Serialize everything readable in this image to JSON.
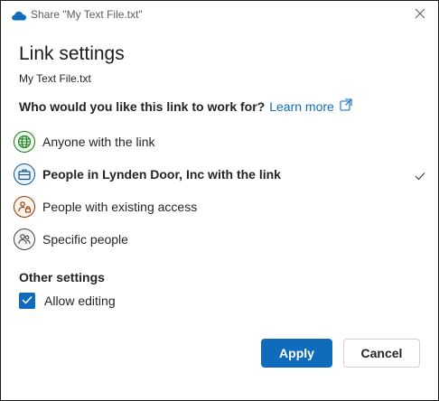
{
  "titlebar": {
    "title": "Share \"My Text File.txt\"",
    "app_icon": "onedrive-cloud-icon",
    "close_icon": "close-icon"
  },
  "dialog": {
    "heading": "Link settings",
    "filename": "My Text File.txt",
    "question": "Who would you like this link to work for?",
    "learn_more": "Learn more",
    "learn_more_icon": "open-in-new-window-icon"
  },
  "options": [
    {
      "label": "Anyone with the link",
      "icon": "globe-icon",
      "selected": false
    },
    {
      "label": "People in Lynden Door, Inc with the link",
      "icon": "organization-briefcase-icon",
      "selected": true
    },
    {
      "label": "People with existing access",
      "icon": "people-lock-icon",
      "selected": false
    },
    {
      "label": "Specific people",
      "icon": "people-icon",
      "selected": false
    }
  ],
  "other_settings": {
    "heading": "Other settings",
    "allow_editing": {
      "label": "Allow editing",
      "checked": true
    }
  },
  "buttons": {
    "apply": "Apply",
    "cancel": "Cancel"
  },
  "colors": {
    "accent": "#0f6cbd",
    "anyone_icon": "#107c10",
    "org_icon": "#0f548c",
    "existing_icon": "#8a3707",
    "specific_icon": "#424242"
  }
}
